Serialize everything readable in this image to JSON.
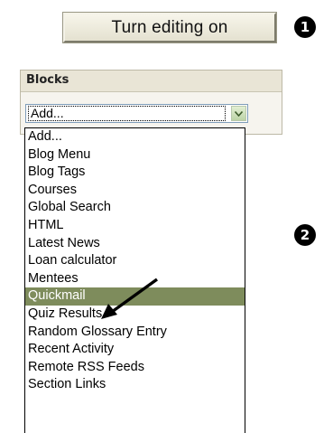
{
  "toolbar": {
    "turn_editing_label": "Turn editing on"
  },
  "markers": {
    "step1": "1",
    "step2": "2"
  },
  "blocks": {
    "title": "Blocks",
    "select_value": "Add...",
    "options": [
      "Add...",
      "Blog Menu",
      "Blog Tags",
      "Courses",
      "Global Search",
      "HTML",
      "Latest News",
      "Loan calculator",
      "Mentees",
      "Quickmail",
      "Quiz Results",
      "Random Glossary Entry",
      "Recent Activity",
      "Remote RSS Feeds",
      "Section Links"
    ],
    "selected_option": "Quickmail"
  },
  "colors": {
    "selected_bg": "#7e8c5c",
    "header_bg": "#e9e5d6"
  }
}
